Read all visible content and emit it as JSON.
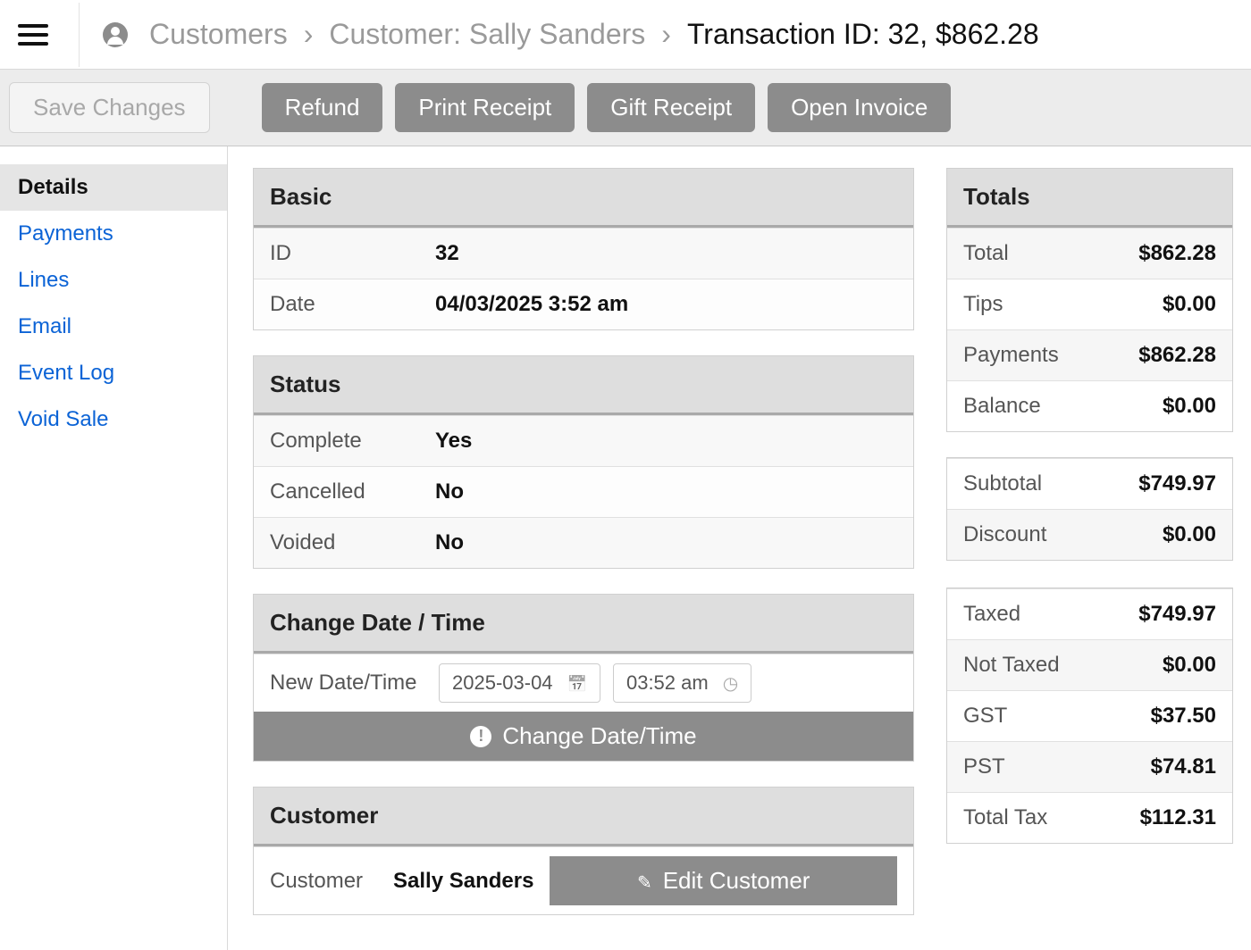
{
  "breadcrumb": {
    "root": "Customers",
    "customer": "Customer: Sally Sanders",
    "current": "Transaction ID: 32, $862.28"
  },
  "actions": {
    "save": "Save Changes",
    "refund": "Refund",
    "print": "Print Receipt",
    "gift": "Gift Receipt",
    "invoice": "Open Invoice"
  },
  "sidebar": {
    "items": [
      {
        "label": "Details",
        "active": true
      },
      {
        "label": "Payments",
        "active": false
      },
      {
        "label": "Lines",
        "active": false
      },
      {
        "label": "Email",
        "active": false
      },
      {
        "label": "Event Log",
        "active": false
      },
      {
        "label": "Void Sale",
        "active": false
      }
    ]
  },
  "basic": {
    "heading": "Basic",
    "id_label": "ID",
    "id_value": "32",
    "date_label": "Date",
    "date_value": "04/03/2025 3:52 am"
  },
  "status": {
    "heading": "Status",
    "complete_label": "Complete",
    "complete_value": "Yes",
    "cancelled_label": "Cancelled",
    "cancelled_value": "No",
    "voided_label": "Voided",
    "voided_value": "No"
  },
  "changedt": {
    "heading": "Change Date / Time",
    "new_label": "New Date/Time",
    "date_value": "2025-03-04",
    "time_value": "03:52 am",
    "button": "Change Date/Time"
  },
  "customer": {
    "heading": "Customer",
    "label": "Customer",
    "name": "Sally Sanders",
    "edit": "Edit Customer"
  },
  "totals": {
    "heading": "Totals",
    "rows1": [
      {
        "label": "Total",
        "value": "$862.28"
      },
      {
        "label": "Tips",
        "value": "$0.00"
      },
      {
        "label": "Payments",
        "value": "$862.28"
      },
      {
        "label": "Balance",
        "value": "$0.00"
      }
    ],
    "rows2": [
      {
        "label": "Subtotal",
        "value": "$749.97"
      },
      {
        "label": "Discount",
        "value": "$0.00"
      }
    ],
    "rows3": [
      {
        "label": "Taxed",
        "value": "$749.97"
      },
      {
        "label": "Not Taxed",
        "value": "$0.00"
      },
      {
        "label": "GST",
        "value": "$37.50"
      },
      {
        "label": "PST",
        "value": "$74.81"
      },
      {
        "label": "Total Tax",
        "value": "$112.31"
      }
    ]
  }
}
